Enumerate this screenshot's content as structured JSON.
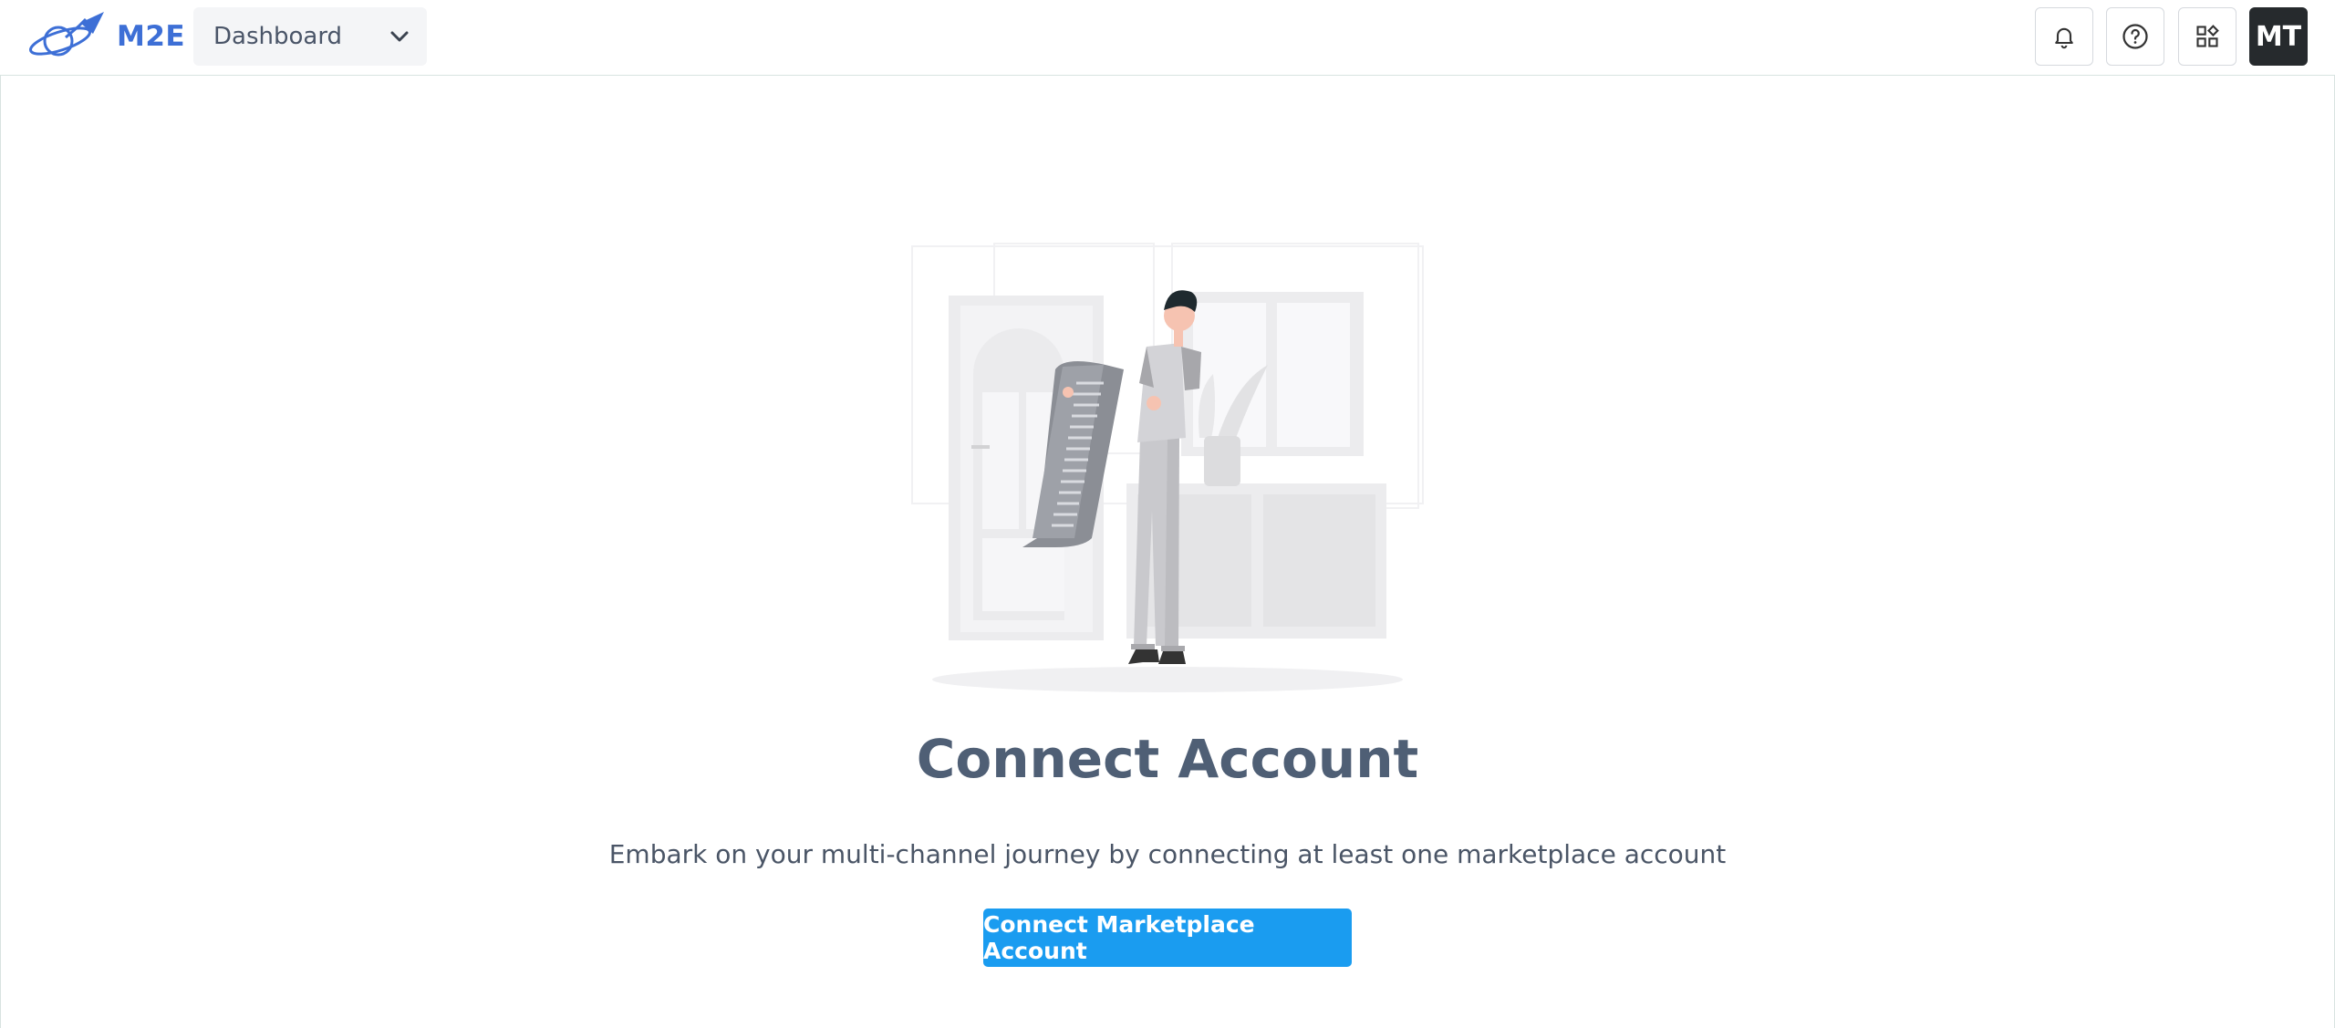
{
  "header": {
    "logo_text": "M2E",
    "nav_select": {
      "value": "Dashboard"
    },
    "actions": {
      "notifications_icon": "bell-icon",
      "help_icon": "help-circle-icon",
      "apps_icon": "apps-grid-icon"
    },
    "avatar_initials": "MT"
  },
  "empty_state": {
    "title": "Connect Account",
    "description": "Embark on your multi-channel journey by connecting at least one marketplace account",
    "button_label": "Connect Marketplace Account"
  },
  "colors": {
    "brand": "#3d6fd6",
    "primary_button": "#1a9cf0",
    "title": "#4f5f75",
    "avatar_bg": "#262a2d"
  }
}
